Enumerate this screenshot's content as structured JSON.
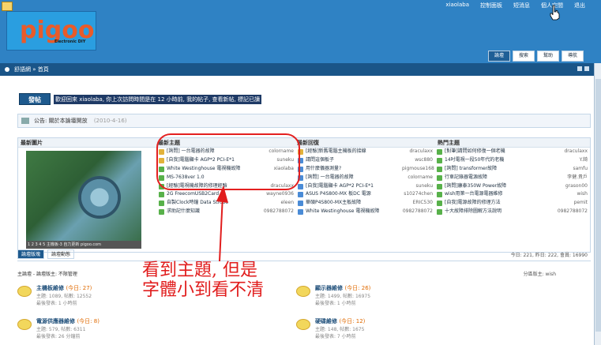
{
  "header": {
    "logo_text": "pigoo",
    "logo_tagline": "Electronic DIY",
    "topnav": [
      "xiaolaba",
      "控制面板",
      "短消息",
      "個人空間",
      "退出"
    ]
  },
  "main_tabs": [
    "論壇",
    "搜索",
    "幫助",
    "導航"
  ],
  "breadcrumb": "舒語網 » 首頁",
  "new_post_button": "發帖",
  "welcome_text": "歡迎回來 xiaolaba, 你上次訪問時間是在 12 小時前, 我的帖子, 查看新帖, 標記已讀",
  "announcement": {
    "label": "公告:",
    "title": "關於本論壇開放",
    "date": "(2010-4-16)"
  },
  "grid_headers": [
    "最新圖片",
    "最新主題",
    "最新回復",
    "熱門主題"
  ],
  "photo_caption": "1 2 3 4 5   主機板-3 自力更新 pigoo.com",
  "latest_threads": [
    {
      "title": "[詢問] 一台電器的故障",
      "author": "colorname",
      "icon": "y"
    },
    {
      "title": "[自我]電腦顯卡 AGP*2 PCI-E*1",
      "author": "suneku",
      "icon": "y"
    },
    {
      "title": "White Westinghouse 電視機故障",
      "author": "xiaolaba",
      "icon": "g"
    },
    {
      "title": "MS-7638ver 1.0",
      "author": "",
      "icon": "g"
    },
    {
      "title": "[經驗]電視機故障的修理經驗",
      "author": "draculaxx",
      "icon": "g"
    },
    {
      "title": "2G FreecomUSB2Card",
      "author": "wayne0936",
      "icon": "g"
    },
    {
      "title": "自製Clock時鐘 Data Strobe",
      "author": "eleen",
      "icon": "g"
    },
    {
      "title": "求助記什麼知識",
      "author": "0982788072",
      "icon": "g"
    }
  ],
  "latest_replies": [
    {
      "title": "[經驗]新舊電腦主機板的接線",
      "author": "draculaxx",
      "icon": "y"
    },
    {
      "title": "請問這個板子",
      "author": "wsc880",
      "icon": "b"
    },
    {
      "title": "用什麼儀器測量?",
      "author": "pigmouse168",
      "icon": "b"
    },
    {
      "title": "[詢問] 一台電器的故障",
      "author": "colorname",
      "icon": "b"
    },
    {
      "title": "[自我]電腦顯卡 AGP*2 PCI-E*1",
      "author": "suneku",
      "icon": "b"
    },
    {
      "title": "ASUS P4S800-MX 板DC 電源",
      "author": "s10274chen",
      "icon": "b"
    },
    {
      "title": "華碩P4S800-MX主板故障",
      "author": "ERIC530",
      "icon": "b"
    },
    {
      "title": "White Westinghouse 電視機故障",
      "author": "0982788072",
      "icon": "b"
    }
  ],
  "hot_threads": [
    {
      "title": "[對筆]請問如何修復一個老機",
      "author": "draculaxx",
      "icon": "g"
    },
    {
      "title": "14吋電視一段50年代的老機",
      "author": "Y.錡",
      "icon": "g"
    },
    {
      "title": "[詢問] transformer故障",
      "author": "samfu",
      "icon": "g"
    },
    {
      "title": "行車記錄器電源故障",
      "author": "李健.貴戶",
      "icon": "g"
    },
    {
      "title": "[詢問]康泰350W Power故障",
      "author": "grason00",
      "icon": "g"
    },
    {
      "title": "wish用第一台電源電器維修",
      "author": "wish",
      "icon": "g"
    },
    {
      "title": "[自我]電源故障的修理方法",
      "author": "pemit",
      "icon": "g"
    },
    {
      "title": "十大故障排除圖解方法說明",
      "author": "0982788072",
      "icon": "g"
    }
  ],
  "bottom_tabs": [
    "論壇版塊",
    "論壇動態"
  ],
  "stats_line": "今日: 221, 昨日: 222, 會員: 16990",
  "forum_header": "主論壇 - 論壇版主: 不限管理",
  "forum_right": "分區版主: wish",
  "forums": [
    {
      "name": "主機板維修",
      "today": "(今日: 27)",
      "meta": "主題: 1089, 帖數: 12552",
      "last": "最後發表: 1 小時前"
    },
    {
      "name": "顯示器維修",
      "today": "(今日: 26)",
      "meta": "主題: 1499, 帖數: 16975",
      "last": "最後發表: 1 小時前"
    },
    {
      "name": "電源供應器維修",
      "today": "(今日: 8)",
      "meta": "主題: 579, 帖數: 6311",
      "last": "最後發表: 26 分鐘前"
    },
    {
      "name": "硬碟維修",
      "today": "(今日: 12)",
      "meta": "主題: 148, 帖數: 1675",
      "last": "最後發表: 7 小時前"
    }
  ],
  "annotation_text": [
    "看到主題, 但是",
    "字體小到看不清"
  ],
  "colors": {
    "header_bg": "#2f82c4",
    "accent": "#1e5a8e",
    "annotation": "#e11d1d"
  }
}
